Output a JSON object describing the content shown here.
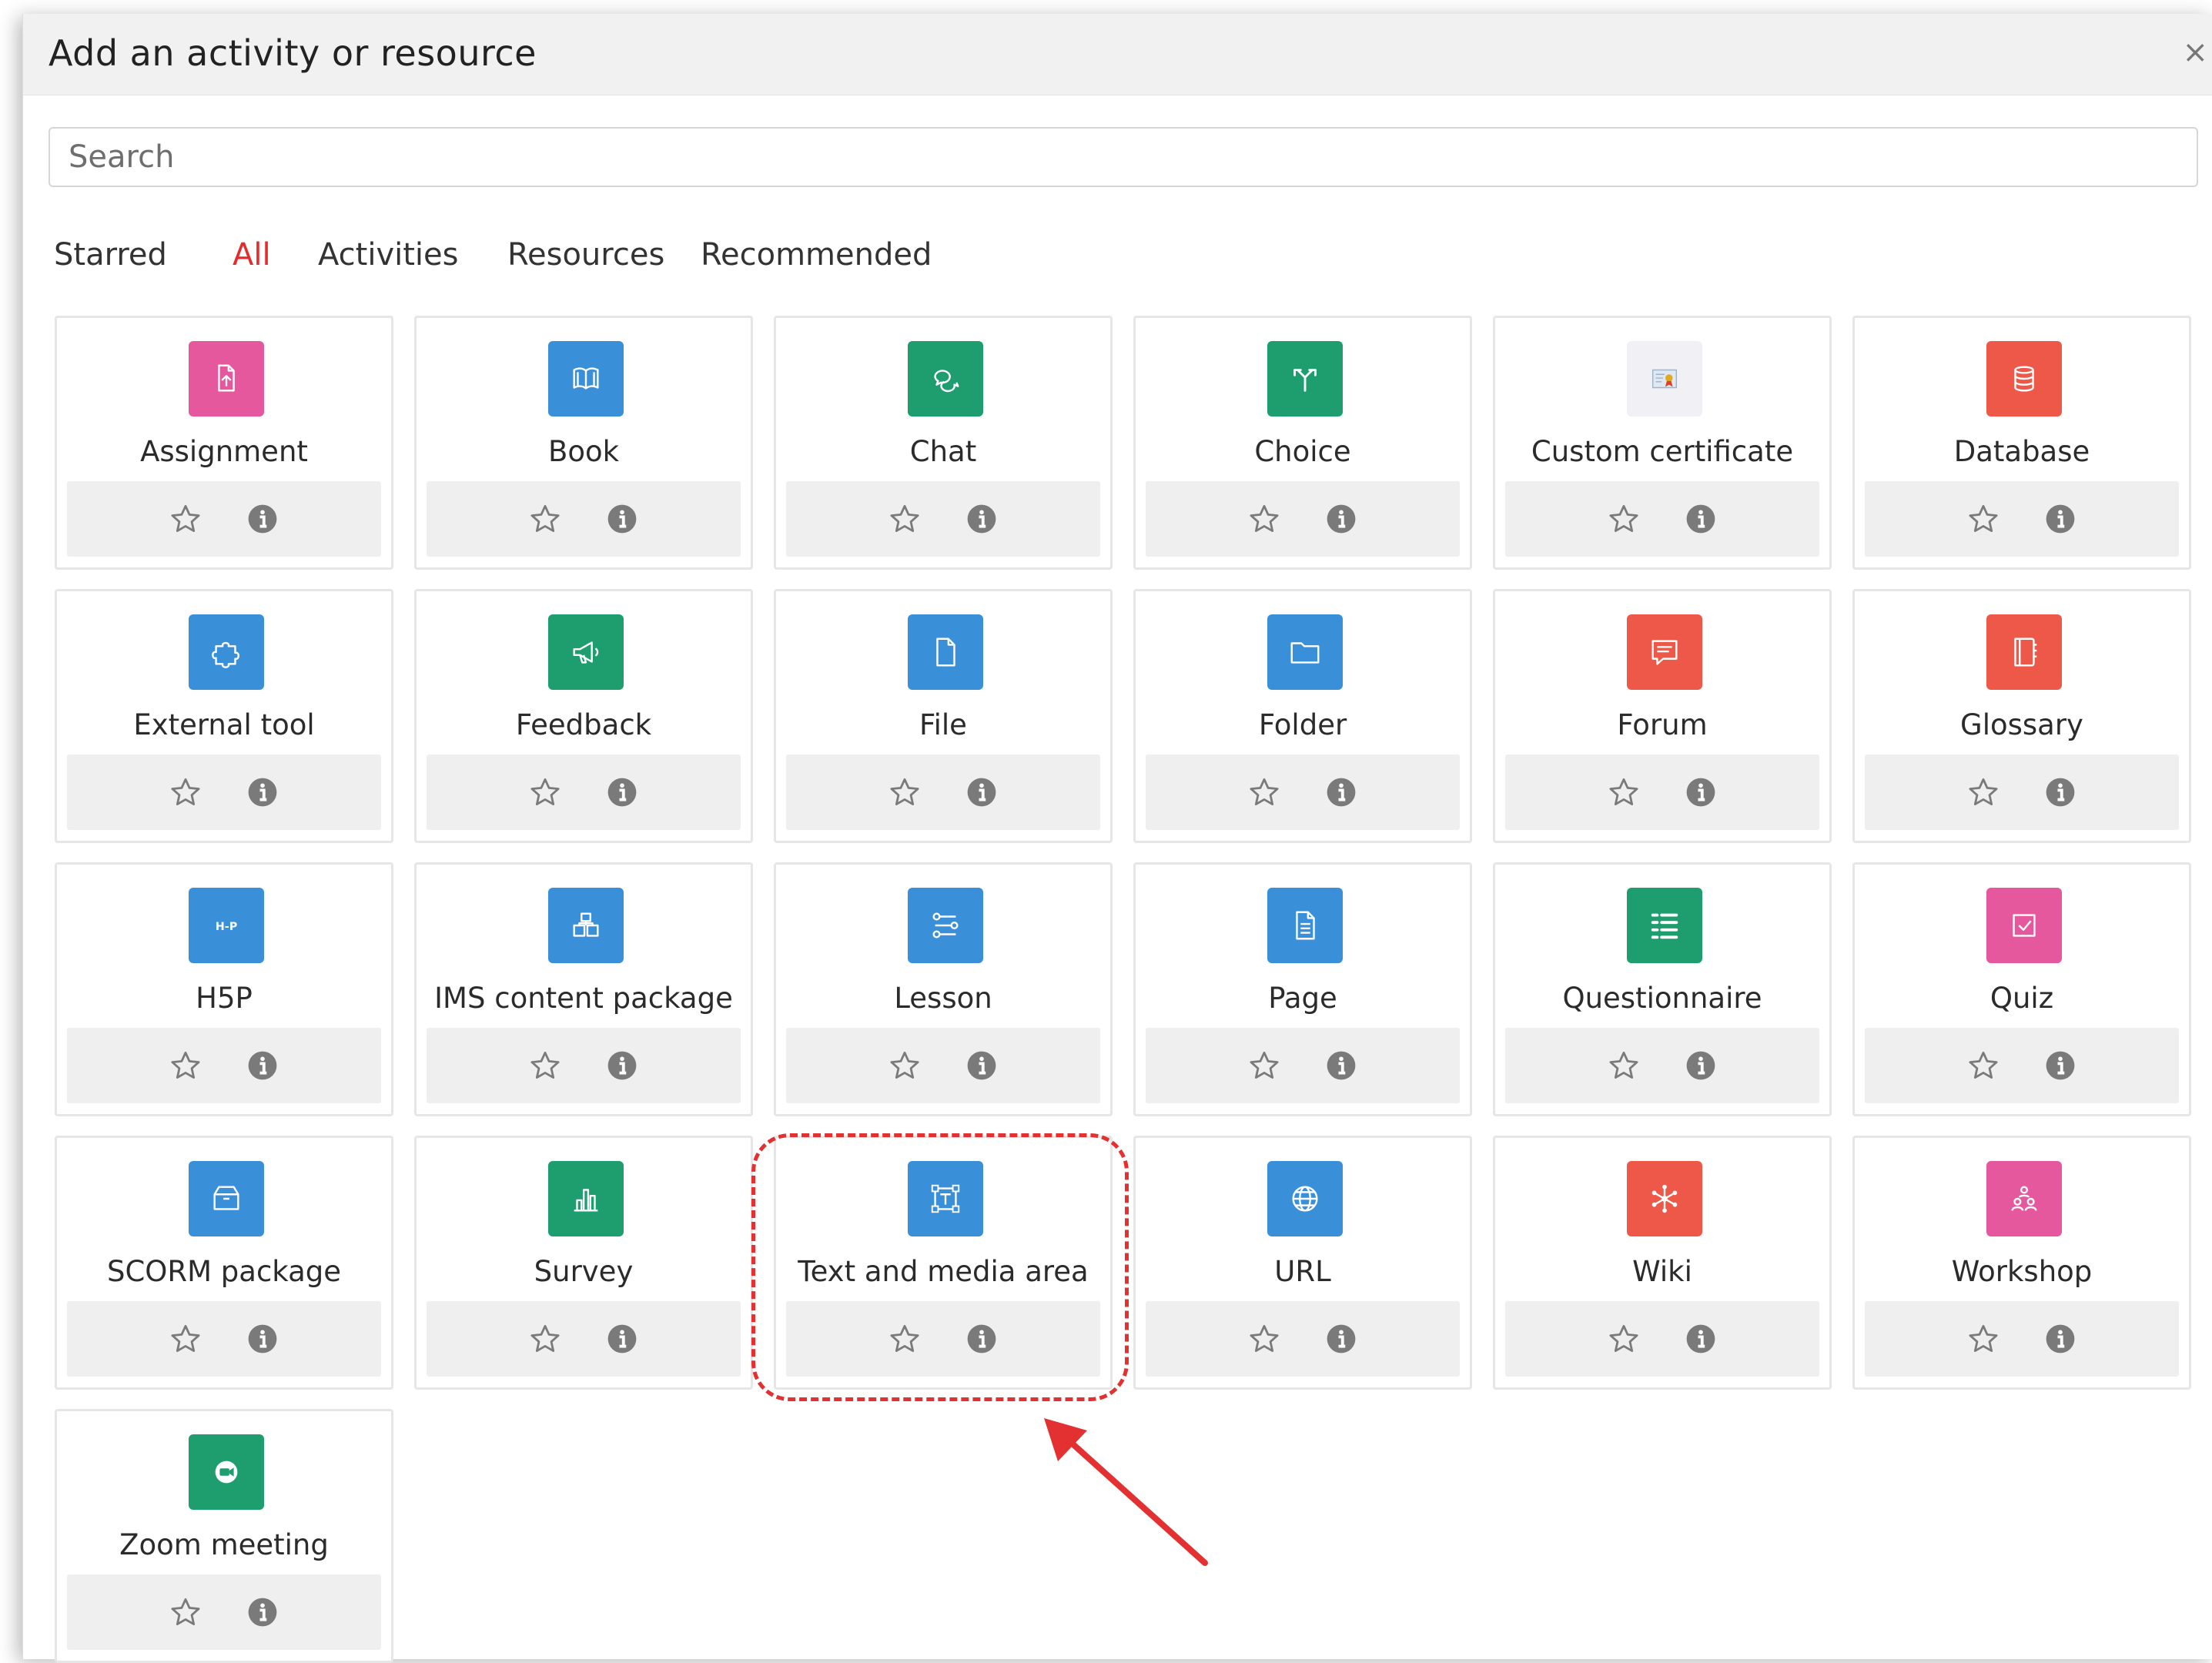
{
  "dialog": {
    "title": "Add an activity or resource",
    "close_label": "×",
    "search_placeholder": "Search"
  },
  "tabs": [
    {
      "label": "Starred",
      "active": false
    },
    {
      "label": "All",
      "active": true
    },
    {
      "label": "Activities",
      "active": false
    },
    {
      "label": "Resources",
      "active": false
    },
    {
      "label": "Recommended",
      "active": false
    }
  ],
  "colors": {
    "accent": "#e52c2c",
    "pink": "#e6589e",
    "blue": "#3a8fd9",
    "green": "#1e9e6e",
    "red": "#ee5848",
    "annotation": "#e33030"
  },
  "items": [
    {
      "name": "Assignment",
      "color": "#e6589e",
      "icon": "assignment-icon"
    },
    {
      "name": "Book",
      "color": "#3a8fd9",
      "icon": "book-icon"
    },
    {
      "name": "Chat",
      "color": "#1e9e6e",
      "icon": "chat-icon"
    },
    {
      "name": "Choice",
      "color": "#1e9e6e",
      "icon": "choice-icon"
    },
    {
      "name": "Custom certificate",
      "color": "#f1f1f5",
      "icon": "certificate-icon"
    },
    {
      "name": "Database",
      "color": "#ee5848",
      "icon": "database-icon"
    },
    {
      "name": "External tool",
      "color": "#3a8fd9",
      "icon": "puzzle-icon"
    },
    {
      "name": "Feedback",
      "color": "#1e9e6e",
      "icon": "megaphone-icon"
    },
    {
      "name": "File",
      "color": "#3a8fd9",
      "icon": "file-icon"
    },
    {
      "name": "Folder",
      "color": "#3a8fd9",
      "icon": "folder-icon"
    },
    {
      "name": "Forum",
      "color": "#ee5848",
      "icon": "forum-icon"
    },
    {
      "name": "Glossary",
      "color": "#ee5848",
      "icon": "glossary-icon"
    },
    {
      "name": "H5P",
      "color": "#3a8fd9",
      "icon": "h5p-icon",
      "icon_text": "H-P"
    },
    {
      "name": "IMS content package",
      "color": "#3a8fd9",
      "icon": "package-icon"
    },
    {
      "name": "Lesson",
      "color": "#3a8fd9",
      "icon": "lesson-icon"
    },
    {
      "name": "Page",
      "color": "#3a8fd9",
      "icon": "page-icon"
    },
    {
      "name": "Questionnaire",
      "color": "#1e9e6e",
      "icon": "questionnaire-icon"
    },
    {
      "name": "Quiz",
      "color": "#e6589e",
      "icon": "quiz-icon"
    },
    {
      "name": "SCORM package",
      "color": "#3a8fd9",
      "icon": "scorm-icon"
    },
    {
      "name": "Survey",
      "color": "#1e9e6e",
      "icon": "survey-icon"
    },
    {
      "name": "Text and media area",
      "color": "#3a8fd9",
      "icon": "text-media-icon"
    },
    {
      "name": "URL",
      "color": "#3a8fd9",
      "icon": "globe-icon"
    },
    {
      "name": "Wiki",
      "color": "#ee5848",
      "icon": "wiki-icon"
    },
    {
      "name": "Workshop",
      "color": "#e6589e",
      "icon": "workshop-icon"
    },
    {
      "name": "Zoom meeting",
      "color": "#1e9e6e",
      "icon": "zoom-icon"
    }
  ],
  "annotation": {
    "highlighted_item": "Text and media area"
  }
}
